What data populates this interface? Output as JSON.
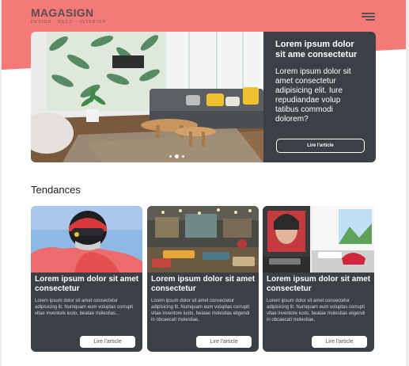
{
  "brand": {
    "name": "MAGASIGN",
    "tagline": "DESIGN · DECO · INTERIOR"
  },
  "colors": {
    "accent": "#f47a78",
    "panel": "#3b3f46",
    "text_dark": "#5a4e50"
  },
  "header": {
    "menu_icon": "hamburger-menu-icon"
  },
  "featured": {
    "title": "Lorem ipsum dolor sit ame consectetur",
    "text": "Lorem ipsum dolor sit amet consectetur adipisicing elit. Iure repudiandae volup tatibus commodi dolorem?",
    "button_label": "Lire l'article",
    "carousel_pages": 3,
    "carousel_active": 2
  },
  "section": {
    "title": "Tendances"
  },
  "cards": [
    {
      "title": "Lorem ipsum dolor sit amet consectetur",
      "text": "Lorem ipsum dolor sit amet consectetur adipisicing lit. Numquam eum voluptas corrupti vitae inventore iusto, beatae molestias...",
      "button_label": "Lire l'article"
    },
    {
      "title": "Lorem ipsum dolor sit amet consectetur",
      "text": "Lorem ipsum dolor sit amet consectetur adipisicing lit. Numquam eum voluptas corrupti vitae inventore iusto, beatae molestias eligendi in obcaecati molestiae,",
      "button_label": "Lire l'article"
    },
    {
      "title": "Lorem ipsum dolor sit amet consectetur",
      "text": "Lorem ipsum dolor sit amet consectetur adipisicing lit. Numquam eum voluptas corrupti vitae inventore iusto, beatae molestias eligendi in obcaecati molestiae,",
      "button_label": "Lire l'article"
    }
  ]
}
